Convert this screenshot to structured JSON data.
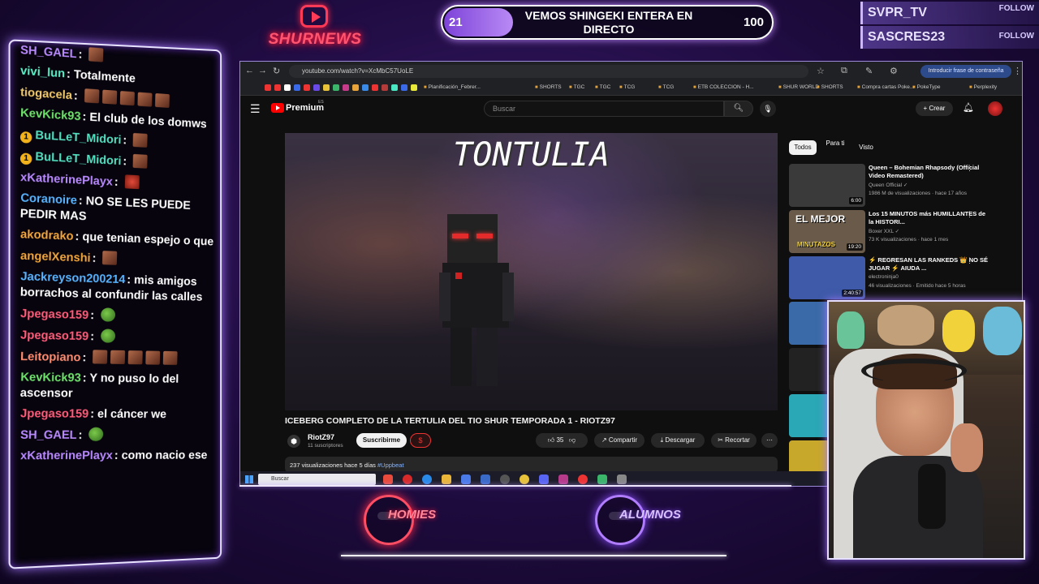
{
  "overlay": {
    "brand": "SHURNEWS",
    "goal": {
      "start": "21",
      "title": "VEMOS SHINGEKI ENTERA EN DIRECTO",
      "end": "100",
      "progress": 0.21
    },
    "follows": [
      {
        "name": "SVPR_TV",
        "tag": "FOLLOW"
      },
      {
        "name": "SASCRES23",
        "tag": "FOLLOW"
      }
    ],
    "badges": {
      "homies": "HOMIES",
      "alumnos": "ALUMNOS"
    }
  },
  "chat": [
    {
      "user": "SH_GAEL",
      "color": "#b98aff",
      "text": "",
      "emotes": 1,
      "badge": false
    },
    {
      "user": "vivi_lun",
      "color": "#5cf0c8",
      "text": "Totalmente",
      "emotes": 0,
      "badge": false
    },
    {
      "user": "tiogacela",
      "color": "#f2c96a",
      "text": "",
      "emotes": 5,
      "badge": false
    },
    {
      "user": "KevKick93",
      "color": "#6de36a",
      "text": "El club de los domws",
      "emotes": 0,
      "badge": false
    },
    {
      "user": "BuLLeT_Midori",
      "color": "#52e0c0",
      "text": "",
      "emotes": 1,
      "badge": true
    },
    {
      "user": "BuLLeT_Midori",
      "color": "#52e0c0",
      "text": "",
      "emotes": 1,
      "badge": true
    },
    {
      "user": "xKatherinePlayx",
      "color": "#b98aff",
      "text": "",
      "emotes": 1,
      "badge": false,
      "emote_kind": "red"
    },
    {
      "user": "Coranoire",
      "color": "#58b4ff",
      "text": "NO SE LES PUEDE PEDIR MAS",
      "emotes": 0,
      "badge": false
    },
    {
      "user": "akodrako",
      "color": "#f2a53a",
      "text": "que tenian espejo o que",
      "emotes": 0,
      "badge": false
    },
    {
      "user": "angelXenshi",
      "color": "#f2a53a",
      "text": "",
      "emotes": 1,
      "badge": false
    },
    {
      "user": "Jackreyson200214",
      "color": "#58b4ff",
      "text": "mis amigos borrachos al confundir las calles",
      "emotes": 0,
      "badge": false
    },
    {
      "user": "Jpegaso159",
      "color": "#ff5c7a",
      "text": "",
      "emotes": 1,
      "badge": false,
      "emote_kind": "pepe"
    },
    {
      "user": "Jpegaso159",
      "color": "#ff5c7a",
      "text": "",
      "emotes": 1,
      "badge": false,
      "emote_kind": "pepe"
    },
    {
      "user": "Leitopiano",
      "color": "#ff8c70",
      "text": "",
      "emotes": 5,
      "badge": false
    },
    {
      "user": "KevKick93",
      "color": "#6de36a",
      "text": "Y no puso lo del ascensor",
      "emotes": 0,
      "badge": false
    },
    {
      "user": "Jpegaso159",
      "color": "#ff5c7a",
      "text": "el cáncer we",
      "emotes": 0,
      "badge": false
    },
    {
      "user": "SH_GAEL",
      "color": "#b98aff",
      "text": "",
      "emotes": 1,
      "badge": false,
      "emote_kind": "pepe"
    },
    {
      "user": "xKatherinePlayx",
      "color": "#b98aff",
      "text": "como nacio ese",
      "emotes": 0,
      "badge": false
    }
  ],
  "browser": {
    "url": "youtube.com/watch?v=XcMbC57UoLE",
    "password_btn": "Introducir frase de contraseña",
    "bookmarks": [
      "Planificación_Febrer...",
      "SHORTS",
      "TGC",
      "TGC",
      "TCG",
      "TCG",
      "ETB COLECCION - H...",
      "SHUR WORLD",
      "SHORTS",
      "Compra cartas Poke...",
      "PokeType",
      "Perplexity"
    ]
  },
  "youtube": {
    "brand": "Premium",
    "country": "ES",
    "search_placeholder": "Buscar",
    "create": "+ Crear",
    "video_overlay_title": "TONTULIA",
    "video_title": "ICEBERG COMPLETO DE LA TERTULIA DEL TIO SHUR TEMPORADA 1 - RIOTZ97",
    "channel": "RiotZ97",
    "subs": "11 suscriptores",
    "subscribe": "Suscribirme",
    "join_icon": "$",
    "likes": "35",
    "share": "Compartir",
    "download": "Descargar",
    "clip": "Recortar",
    "desc": {
      "views": "237 visualizaciones  hace 5 días",
      "tag": "#Uppbeat"
    },
    "chips": [
      "Todos",
      "Para ti",
      "Visto"
    ],
    "recs": [
      {
        "title": "Queen – Bohemian Rhapsody (Official Video Remastered)",
        "channel": "Queen Official ✓",
        "meta": "1986 M de visualizaciones · hace 17 años",
        "duration": "6:00",
        "thumb": "#3a3a3a"
      },
      {
        "title": "Los 15 MINUTOS más HUMILLANTES de la HISTORI...",
        "channel": "Boxer XXL ✓",
        "meta": "73 K visualizaciones · hace 1 mes",
        "duration": "19:20",
        "thumb": "#6a5a4a"
      },
      {
        "title": "⚡ REGRESAN LAS RANKEDS 👑 NO SÉ JUGAR ⚡ AIUDA ...",
        "channel": "electroninja0",
        "meta": "46 visualizaciones · Emitido hace 5 horas",
        "duration": "2:40:57",
        "thumb": "#3e5aa8"
      }
    ],
    "rec_thumb_label": "EL MEJOR",
    "rec_thumb_sub": "MINUTAZOS"
  },
  "taskbar": {
    "search": "Buscar"
  }
}
